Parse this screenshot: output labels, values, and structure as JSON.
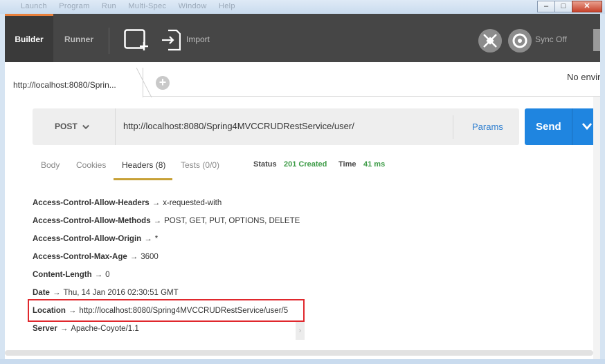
{
  "window": {
    "menu": [
      "Launch",
      "Program",
      "Run",
      "Multi-Spec",
      "Window",
      "Help"
    ],
    "controls": {
      "minimize": "–",
      "maximize": "□",
      "close": "✕"
    }
  },
  "topbar": {
    "builder_label": "Builder",
    "runner_label": "Runner",
    "import_label": "Import",
    "sync_label": "Sync Off",
    "icons": [
      "new-request-icon",
      "import-icon",
      "interceptor-icon",
      "sync-icon"
    ]
  },
  "tabs": {
    "active_label": "http://localhost:8080/Sprin...",
    "add_symbol": "+",
    "environment_label": "No envir"
  },
  "request": {
    "method": "POST",
    "url": "http://localhost:8080/Spring4MVCCRUDRestService/user/",
    "params_label": "Params",
    "send_label": "Send"
  },
  "response": {
    "tabs": [
      "Body",
      "Cookies",
      "Headers (8)",
      "Tests (0/0)"
    ],
    "active_tab": "Headers (8)",
    "status_label": "Status",
    "status_value": "201 Created",
    "time_label": "Time",
    "time_value": "41 ms",
    "arrow": "→",
    "headers": [
      {
        "key": "Access-Control-Allow-Headers",
        "value": "x-requested-with"
      },
      {
        "key": "Access-Control-Allow-Methods",
        "value": "POST, GET, PUT, OPTIONS, DELETE"
      },
      {
        "key": "Access-Control-Allow-Origin",
        "value": "*"
      },
      {
        "key": "Access-Control-Max-Age",
        "value": "3600"
      },
      {
        "key": "Content-Length",
        "value": "0"
      },
      {
        "key": "Date",
        "value": "Thu, 14 Jan 2016 02:30:51 GMT"
      },
      {
        "key": "Location",
        "value": "http://localhost:8080/Spring4MVCCRUDRestService/user/5"
      },
      {
        "key": "Server",
        "value": "Apache-Coyote/1.1"
      }
    ]
  },
  "colors": {
    "accent_orange": "#e8803c",
    "send_blue": "#1f85e0",
    "status_green": "#3c9b46",
    "highlight_red": "#e0282d",
    "tab_underline": "#c7a136"
  }
}
